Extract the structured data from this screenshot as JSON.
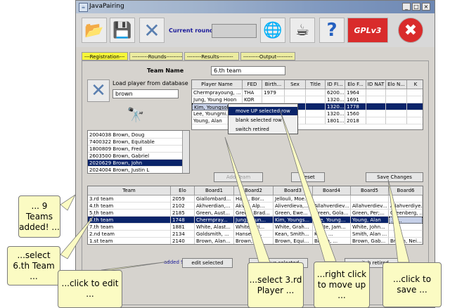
{
  "window": {
    "title": "JavaPairing",
    "minimize": "_",
    "maximize": "□",
    "close": "×"
  },
  "toolbar": {
    "current_round_label": "Current round",
    "buttons": [
      {
        "icon": "folder-open-icon",
        "glyph": "📂"
      },
      {
        "icon": "save-icon",
        "glyph": "💾"
      },
      {
        "icon": "crossed-tools-icon",
        "glyph": "✕"
      },
      {
        "icon": "globe-icon",
        "glyph": "🌐"
      },
      {
        "icon": "teapot-icon",
        "glyph": "☕"
      },
      {
        "icon": "help-icon",
        "glyph": "?"
      },
      {
        "icon": "gpl-v3-icon",
        "glyph": "GPLv3"
      },
      {
        "icon": "exit-icon",
        "glyph": "✖"
      }
    ]
  },
  "tabs": [
    "---Registration---",
    "---------Rounds---------",
    "--------Results--------",
    "---------Output---------"
  ],
  "registration": {
    "team_name_label": "Team Name",
    "team_name_value": "6.th team",
    "load_player_label": "Load player from database",
    "search_value": "brown",
    "db_results": [
      {
        "text": "2004038  Brown, Doug"
      },
      {
        "text": "7400322  Brown, Equitable"
      },
      {
        "text": "1800809  Brown, Fred"
      },
      {
        "text": "2603500  Brown, Gabriel"
      },
      {
        "text": "2020629  Brown, John"
      },
      {
        "text": "2024004  Brown, Justin L"
      }
    ],
    "player_table": {
      "headers": [
        "Player Name",
        "FED",
        "Birth...",
        "Sex",
        "Title",
        "ID FI...",
        "Elo F...",
        "ID NAT",
        "Elo N...",
        "K"
      ],
      "rows": [
        [
          "Chermprayoung, ...",
          "THA",
          "1979",
          "",
          "",
          "6200...",
          "1964",
          "",
          "",
          ""
        ],
        [
          "Jung, Young Hoon",
          "KOR",
          "",
          "",
          "",
          "1320...",
          "1691",
          "",
          "",
          ""
        ],
        [
          "Kim, Youngsok",
          "KOR",
          "",
          "",
          "",
          "1320...",
          "1778",
          "",
          "",
          ""
        ],
        [
          "Lee, Youngmi...",
          "",
          "",
          "",
          "",
          "1320...",
          "1560",
          "",
          "",
          ""
        ],
        [
          "Young, Alan",
          "",
          "",
          "",
          "",
          "1801...",
          "2018",
          "",
          "",
          ""
        ]
      ],
      "selected_row": 2
    },
    "context_menu": [
      "move UP selected row",
      "blank selected row",
      "switch retired"
    ],
    "buttons": {
      "add_team": "Add Team",
      "reset": "Reset",
      "save_changes": "Save Changes",
      "edit_selected": "edit selected",
      "remove_selected": "remove selected",
      "switch_retired": "switch retired"
    },
    "status": "added 9; active 9",
    "team_table": {
      "headers": [
        "Team",
        "Elo",
        "Board1",
        "Board2",
        "Board3",
        "Board4",
        "Board5",
        "Board6"
      ],
      "rows": [
        [
          "3.rd team",
          "2059",
          "Giallombard...",
          "Hal..., Bor...",
          "Jellouli, Moe...",
          "",
          "",
          ""
        ],
        [
          "4.th team",
          "2102",
          "Akhverdian,...",
          "Akv..., Alp...",
          "Aliverdieva,...",
          "Allahverdiev...",
          "Allahverdiev...",
          "Allahverdiye..."
        ],
        [
          "5.th team",
          "2185",
          "Green, Aust...",
          "Green, Brad...",
          "Green, Ewe...",
          "Green, Gola...",
          "Green, Per;...",
          "Greenberg, ..."
        ],
        [
          "6.th team",
          "1748",
          "Chermpray...",
          "Jung, Youn...",
          "Kim, Youngs...",
          "Lee, Young...",
          "Young, Alan",
          "......."
        ],
        [
          "7.th team",
          "1881",
          "White, Alast...",
          "White, Bri...",
          "White, Grah...",
          "White, Jam...",
          "White, John...",
          ""
        ],
        [
          "2.nd team",
          "2134",
          "Goldsmith, ...",
          "Hansen, ...",
          "Kean, Smith...",
          "King, ...",
          "Smith, Alan ...",
          ""
        ],
        [
          "1.st team",
          "2140",
          "Brown, Alan...",
          "Brown, ...",
          "Brown, Equi...",
          "Brown, ...",
          "Brown, Gab...",
          "Brown, Nei..."
        ]
      ],
      "selected_row": 3
    }
  },
  "callouts": {
    "teams_added": "... 9 Teams added! ...",
    "select_team": "...select 6.th Team ...",
    "click_edit": "...click to edit ...",
    "select_player": "...select 3.rd Player ...",
    "right_click": "...right click to move up ...",
    "click_save": "...click to save ..."
  }
}
